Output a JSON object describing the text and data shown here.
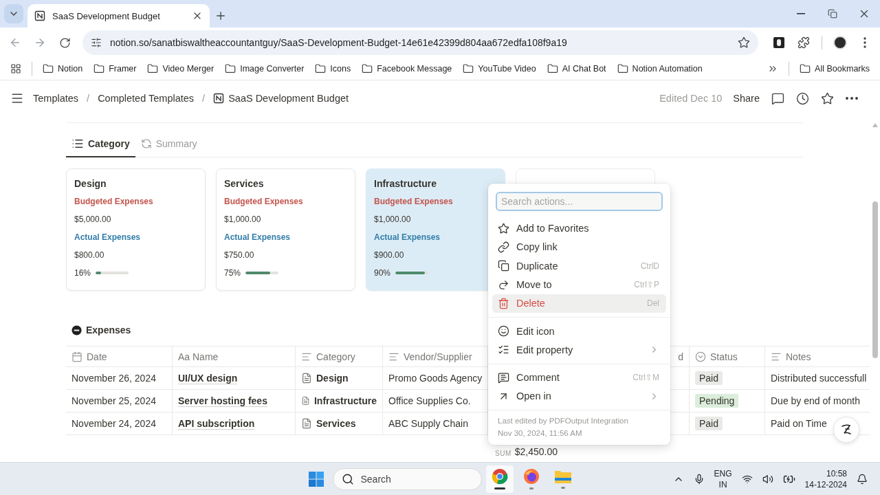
{
  "browser": {
    "tab_title": "SaaS Development Budget",
    "address": "notion.so/sanatbiswaltheaccountantguy/SaaS-Development-Budget-14e61e42399d804aa672edfa108f9a19",
    "bookmarks": [
      "Notion",
      "Framer",
      "Video Merger",
      "Image Converter",
      "Icons",
      "Facebook Message",
      "YouTube Video",
      "AI Chat Bot",
      "Notion Automation"
    ],
    "all_bookmarks": "All Bookmarks"
  },
  "page": {
    "breadcrumbs": [
      "Templates",
      "Completed Templates",
      "SaaS Development Budget"
    ],
    "separator": "/",
    "edited": "Edited Dec 10",
    "share": "Share"
  },
  "views": [
    {
      "label": "Category",
      "selected": true
    },
    {
      "label": "Summary",
      "selected": false
    }
  ],
  "cards": [
    {
      "title": "Design",
      "budget_label": "Budgeted Expenses",
      "budget": "$5,000.00",
      "actual_label": "Actual Expenses",
      "actual": "$800.00",
      "percent": "16%",
      "level": 0.16,
      "selected": false
    },
    {
      "title": "Services",
      "budget_label": "Budgeted Expenses",
      "budget": "$1,000.00",
      "actual_label": "Actual Expenses",
      "actual": "$750.00",
      "percent": "75%",
      "level": 0.75,
      "selected": false
    },
    {
      "title": "Infrastructure",
      "budget_label": "Budgeted Expenses",
      "budget": "$1,000.00",
      "actual_label": "Actual Expenses",
      "actual": "$900.00",
      "percent": "90%",
      "level": 0.9,
      "selected": true
    }
  ],
  "section_title": "Expenses",
  "table": {
    "columns": [
      "Date",
      "Aa Name",
      "Category",
      "Vendor/Supplier",
      "d",
      "Status",
      "Notes"
    ],
    "rows": [
      {
        "date": "November 26, 2024",
        "name": "UI/UX design",
        "category": "Design",
        "vendor": "Promo Goods Agency",
        "status": "Paid",
        "color": "#e9e9e7",
        "notes": "Distributed successfull"
      },
      {
        "date": "November 25, 2024",
        "name": "Server hosting fees",
        "category": "Infrastructure",
        "vendor": "Office Supplies Co.",
        "status": "Pending",
        "color": "#dbeddb",
        "notes": "Due by end of month"
      },
      {
        "date": "November 24, 2024",
        "name": "API subscription",
        "category": "Services",
        "vendor": "ABC Supply Chain",
        "status": "Paid",
        "color": "#e9e9e7",
        "notes": "Paid on Time"
      }
    ],
    "sum_label": "SUM",
    "sum": "$2,450.00"
  },
  "menu": {
    "placeholder": "Search actions...",
    "groups": [
      [
        {
          "label": "Add to Favorites",
          "kind": "action",
          "selected": false,
          "submenu": false
        },
        {
          "label": "Copy link",
          "kind": "action",
          "selected": false,
          "submenu": false
        },
        {
          "label": "Duplicate",
          "shortcut": "CtrlD",
          "kind": "action",
          "selected": false,
          "submenu": false
        },
        {
          "label": "Move to",
          "shortcut": "Ctrl⇧P",
          "kind": "action",
          "selected": false,
          "submenu": false
        },
        {
          "label": "Delete",
          "shortcut": "Del",
          "kind": "danger",
          "selected": true,
          "submenu": false
        }
      ],
      [
        {
          "label": "Edit icon",
          "kind": "action",
          "selected": false,
          "submenu": false
        },
        {
          "label": "Edit property",
          "kind": "action",
          "selected": false,
          "submenu": true
        }
      ],
      [
        {
          "label": "Comment",
          "shortcut": "Ctrl⇧M",
          "kind": "action",
          "selected": false,
          "submenu": false
        },
        {
          "label": "Open in",
          "kind": "action",
          "selected": false,
          "submenu": true
        }
      ]
    ],
    "footer": [
      "Last edited by PDFOutput Integration",
      "Nov 30, 2024, 11:56 AM"
    ]
  },
  "taskbar": {
    "search_placeholder": "Search",
    "apps": [
      {
        "selected": true
      },
      {
        "selected": false
      },
      {
        "selected": false
      }
    ],
    "lang": [
      "ENG",
      "IN"
    ],
    "time": "10:58",
    "date": "14-12-2024"
  }
}
